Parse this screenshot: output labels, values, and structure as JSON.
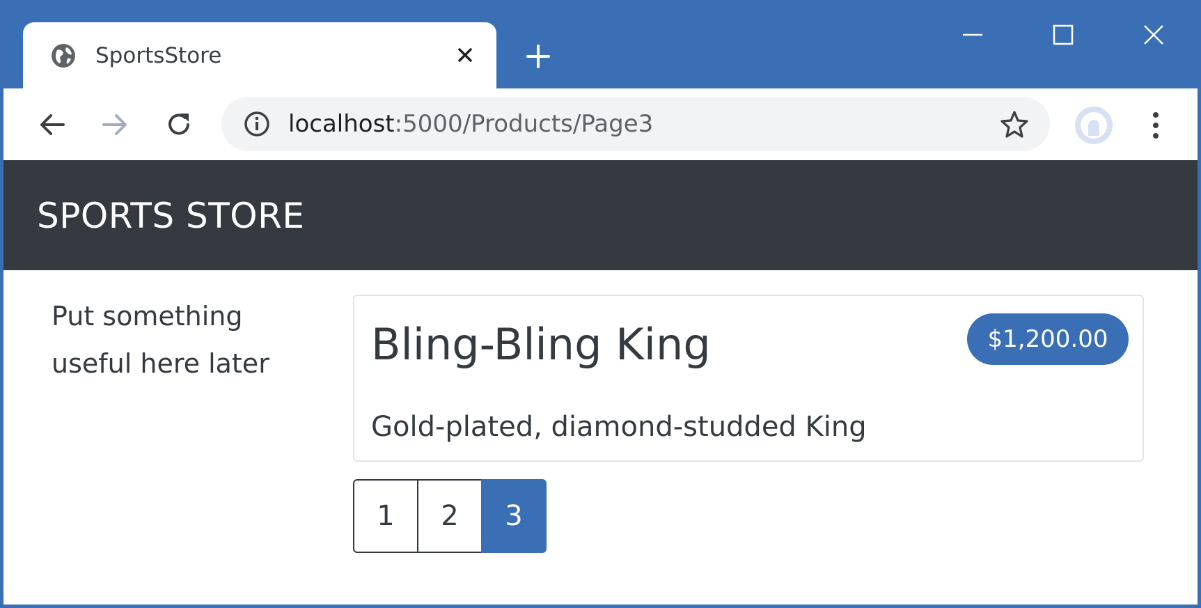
{
  "browser": {
    "tab_title": "SportsStore",
    "url_host": "localhost",
    "url_rest": ":5000/Products/Page3",
    "accent_color": "#3a6fb5"
  },
  "page": {
    "brand": "SPORTS STORE",
    "sidebar_text": "Put something useful here later",
    "product": {
      "name": "Bling-Bling King",
      "price": "$1,200.00",
      "description": "Gold-plated, diamond-studded King"
    },
    "pagination": {
      "pages": [
        "1",
        "2",
        "3"
      ],
      "current": "3"
    },
    "navbar_color": "#343a40"
  }
}
